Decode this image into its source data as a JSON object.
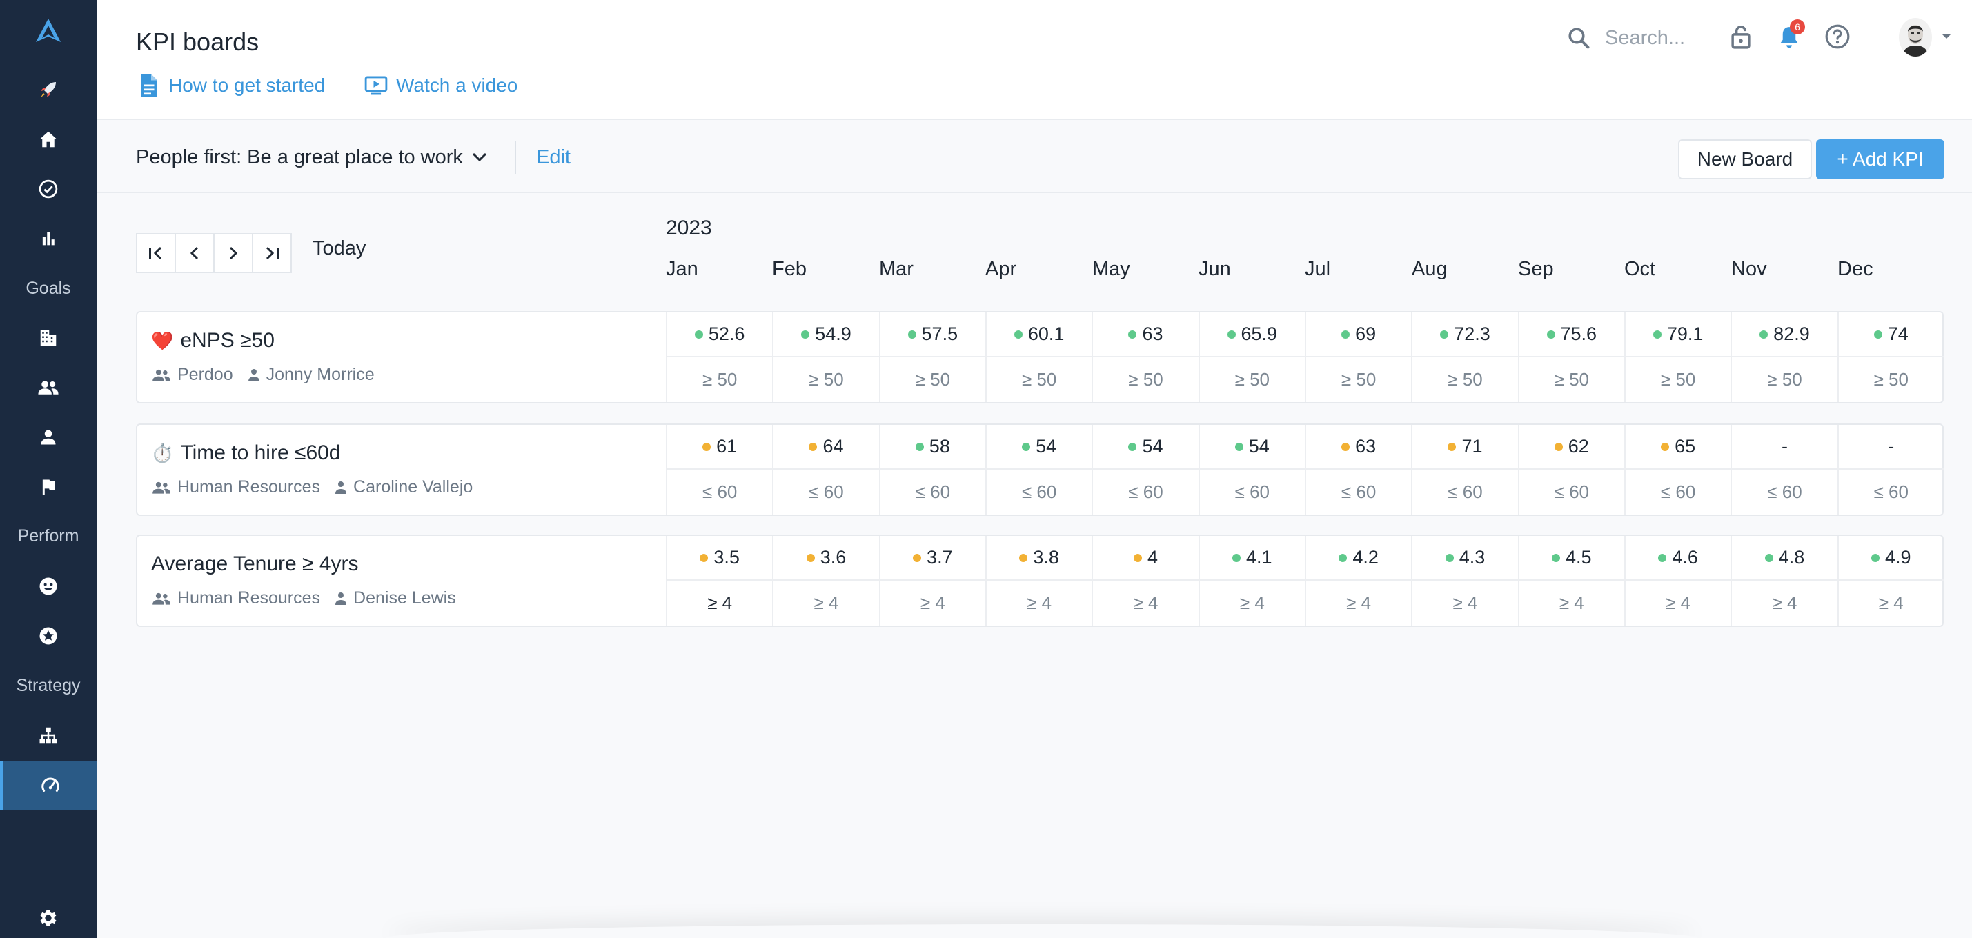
{
  "colors": {
    "sidebar": "#1b2a40",
    "accent": "#4aa3e8",
    "link": "#3a96db",
    "on_track": "#5ec98b",
    "at_risk": "#f2b134",
    "badge": "#e8493f"
  },
  "sidebar": {
    "items": [
      {
        "icon": "rocket-icon"
      },
      {
        "icon": "home-icon"
      },
      {
        "icon": "check-circle-icon"
      },
      {
        "icon": "bar-chart-icon"
      },
      {
        "section_label": "Goals"
      },
      {
        "icon": "building-icon"
      },
      {
        "icon": "group-icon"
      },
      {
        "icon": "person-icon"
      },
      {
        "icon": "flag-icon"
      },
      {
        "section_label": "Perform"
      },
      {
        "icon": "smile-icon"
      },
      {
        "icon": "star-icon"
      },
      {
        "section_label": "Strategy"
      },
      {
        "icon": "hierarchy-icon"
      },
      {
        "icon": "gauge-icon",
        "active": true
      },
      {
        "icon": "gear-icon"
      }
    ]
  },
  "header": {
    "title": "KPI boards",
    "links": {
      "get_started": "How to get started",
      "video": "Watch a video"
    },
    "search_placeholder": "Search...",
    "notification_count": "6"
  },
  "toolbar": {
    "board_name": "People first: Be a great place to work",
    "edit": "Edit",
    "new_board": "New Board",
    "add_kpi": "+ Add KPI"
  },
  "timeline": {
    "today": "Today",
    "year": "2023",
    "months": [
      "Jan",
      "Feb",
      "Mar",
      "Apr",
      "May",
      "Jun",
      "Jul",
      "Aug",
      "Sep",
      "Oct",
      "Nov",
      "Dec"
    ]
  },
  "kpis": [
    {
      "emoji": "❤️",
      "name": "eNPS ≥50",
      "team": "Perdoo",
      "owner": "Jonny Morrice",
      "values": [
        "52.6",
        "54.9",
        "57.5",
        "60.1",
        "63",
        "65.9",
        "69",
        "72.3",
        "75.6",
        "79.1",
        "82.9",
        "74"
      ],
      "status": [
        "green",
        "green",
        "green",
        "green",
        "green",
        "green",
        "green",
        "green",
        "green",
        "green",
        "green",
        "green"
      ],
      "targets": [
        "≥ 50",
        "≥ 50",
        "≥ 50",
        "≥ 50",
        "≥ 50",
        "≥ 50",
        "≥ 50",
        "≥ 50",
        "≥ 50",
        "≥ 50",
        "≥ 50",
        "≥ 50"
      ]
    },
    {
      "emoji": "⏱️",
      "name": "Time to hire ≤60d",
      "team": "Human Resources",
      "owner": "Caroline Vallejo",
      "values": [
        "61",
        "64",
        "58",
        "54",
        "54",
        "54",
        "63",
        "71",
        "62",
        "65",
        "-",
        "-"
      ],
      "status": [
        "orange",
        "orange",
        "green",
        "green",
        "green",
        "green",
        "orange",
        "orange",
        "orange",
        "orange",
        "none",
        "none"
      ],
      "targets": [
        "≤ 60",
        "≤ 60",
        "≤ 60",
        "≤ 60",
        "≤ 60",
        "≤ 60",
        "≤ 60",
        "≤ 60",
        "≤ 60",
        "≤ 60",
        "≤ 60",
        "≤ 60"
      ]
    },
    {
      "emoji": "",
      "name": "Average Tenure ≥ 4yrs",
      "team": "Human Resources",
      "owner": "Denise Lewis",
      "values": [
        "3.5",
        "3.6",
        "3.7",
        "3.8",
        "4",
        "4.1",
        "4.2",
        "4.3",
        "4.5",
        "4.6",
        "4.8",
        "4.9"
      ],
      "status": [
        "orange",
        "orange",
        "orange",
        "orange",
        "orange",
        "green",
        "green",
        "green",
        "green",
        "green",
        "green",
        "green"
      ],
      "targets": [
        "≥ 4",
        "≥ 4",
        "≥ 4",
        "≥ 4",
        "≥ 4",
        "≥ 4",
        "≥ 4",
        "≥ 4",
        "≥ 4",
        "≥ 4",
        "≥ 4",
        "≥ 4"
      ]
    }
  ]
}
